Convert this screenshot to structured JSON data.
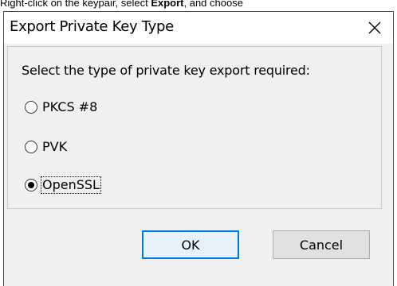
{
  "caption": {
    "prefix": "Right-click on the keypair, select ",
    "bold": "Export",
    "suffix": ", and choose"
  },
  "dialog": {
    "title": "Export Private Key Type",
    "close_icon": "close-icon",
    "prompt": "Select the type of private key export required:",
    "options": [
      {
        "label": "PKCS #8",
        "selected": false
      },
      {
        "label": "PVK",
        "selected": false
      },
      {
        "label": "OpenSSL",
        "selected": true
      }
    ],
    "ok_label": "OK",
    "cancel_label": "Cancel",
    "accent_color": "#0078d7"
  }
}
